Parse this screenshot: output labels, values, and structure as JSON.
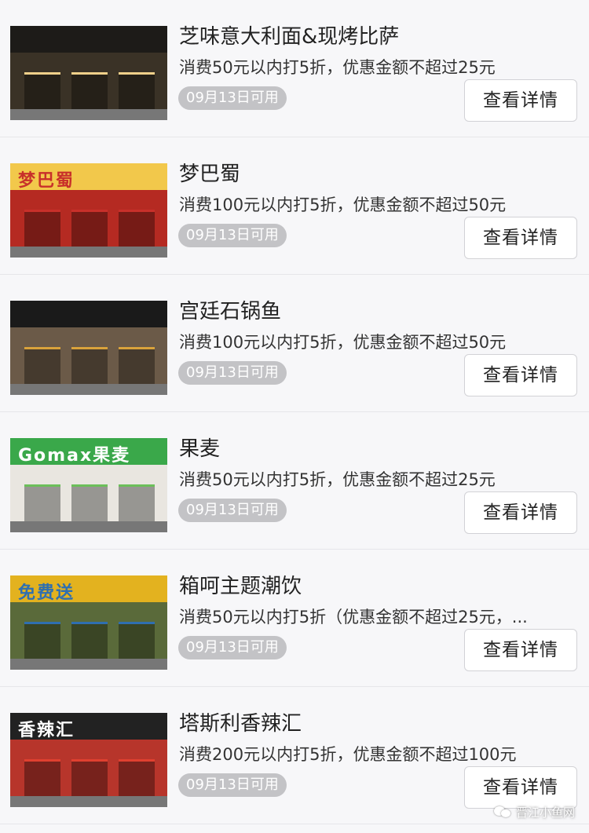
{
  "items": [
    {
      "name": "芝味意大利面&现烤比萨",
      "desc": "消费50元以内打5折，优惠金额不超过25元",
      "badge": "09月13日可用",
      "button": "查看详情",
      "thumb_sign": "",
      "colors": {
        "sign": "#1d1b18",
        "front": "#3a3226",
        "accent": "#f0d08a"
      }
    },
    {
      "name": "梦巴蜀",
      "desc": "消费100元以内打5折，优惠金额不超过50元",
      "badge": "09月13日可用",
      "button": "查看详情",
      "thumb_sign": "梦巴蜀",
      "colors": {
        "sign": "#f2c84b",
        "front": "#b52a22",
        "accent": "#c8302a"
      }
    },
    {
      "name": "宫廷石锅鱼",
      "desc": "消费100元以内打5折，优惠金额不超过50元",
      "badge": "09月13日可用",
      "button": "查看详情",
      "thumb_sign": "",
      "colors": {
        "sign": "#1a1a1a",
        "front": "#6b5a48",
        "accent": "#d9a23b"
      }
    },
    {
      "name": "果麦",
      "desc": "消费50元以内打5折，优惠金额不超过25元",
      "badge": "09月13日可用",
      "button": "查看详情",
      "thumb_sign": "Gomax果麦",
      "colors": {
        "sign": "#3aa84a",
        "front": "#e9e6e0",
        "accent": "#6cbf5a"
      }
    },
    {
      "name": "箱呵主题潮饮",
      "desc": "消费50元以内打5折（优惠金额不超过25元，...",
      "badge": "09月13日可用",
      "button": "查看详情",
      "thumb_sign": "免费送",
      "colors": {
        "sign": "#e3b21f",
        "front": "#5a6a3a",
        "accent": "#2f6fb0"
      }
    },
    {
      "name": "塔斯利香辣汇",
      "desc": "消费200元以内打5折，优惠金额不超过100元",
      "badge": "09月13日可用",
      "button": "查看详情",
      "thumb_sign": "香辣汇",
      "colors": {
        "sign": "#222222",
        "front": "#b7352b",
        "accent": "#e04030"
      }
    }
  ],
  "watermark": {
    "text": "晋江小鱼网",
    "icon": "wechat-icon"
  }
}
